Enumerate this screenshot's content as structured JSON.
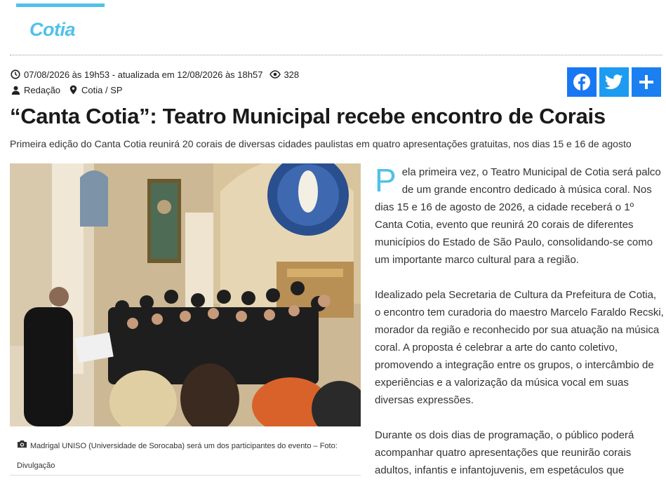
{
  "section": {
    "name": "Cotia",
    "accent": "#4fc1e9"
  },
  "meta": {
    "date_text": "07/08/2026 às 19h53 - atualizada em 12/08/2026 às 18h57",
    "views": "328",
    "author": "Redação",
    "location": "Cotia / SP"
  },
  "share": {
    "facebook_color": "#1877f2",
    "twitter_color": "#1d9bf0",
    "more_color": "#1a7ff0"
  },
  "article": {
    "headline": "“Canta Cotia”: Teatro Municipal recebe encontro de Corais",
    "subtitle": "Primeira edição do Canta Cotia reunirá 20 corais de diversas cidades paulistas em quatro apresentações gratuitas, nos dias 15 e 16 de agosto",
    "photo_caption": "Madrigal UNISO (Universidade de Sorocaba) será um dos participantes do evento – Foto: Divulgação",
    "dropcap": "P",
    "p1_rest": "ela primeira vez, o Teatro Municipal de Cotia será palco de um grande encontro dedicado à música coral. Nos dias 15 e 16 de agosto de 2026, a cidade receberá o 1º Canta Cotia, evento que reunirá 20 corais de diferentes municípios do Estado de São Paulo, consolidando-se como um importante marco cultural para a região.",
    "p2": "Idealizado pela Secretaria de Cultura da Prefeitura de Cotia, o encontro tem curadoria do maestro Marcelo Faraldo Recski, morador da região e reconhecido por sua atuação na música coral. A proposta é celebrar a arte do canto coletivo, promovendo a integração entre os grupos, o intercâmbio de experiências e a valorização da música vocal em suas diversas expressões.",
    "p3": "Durante os dois dias de programação, o público poderá acompanhar quatro apresentações que reunirão corais adultos, infantis e infantojuvenis, em espetáculos que"
  }
}
